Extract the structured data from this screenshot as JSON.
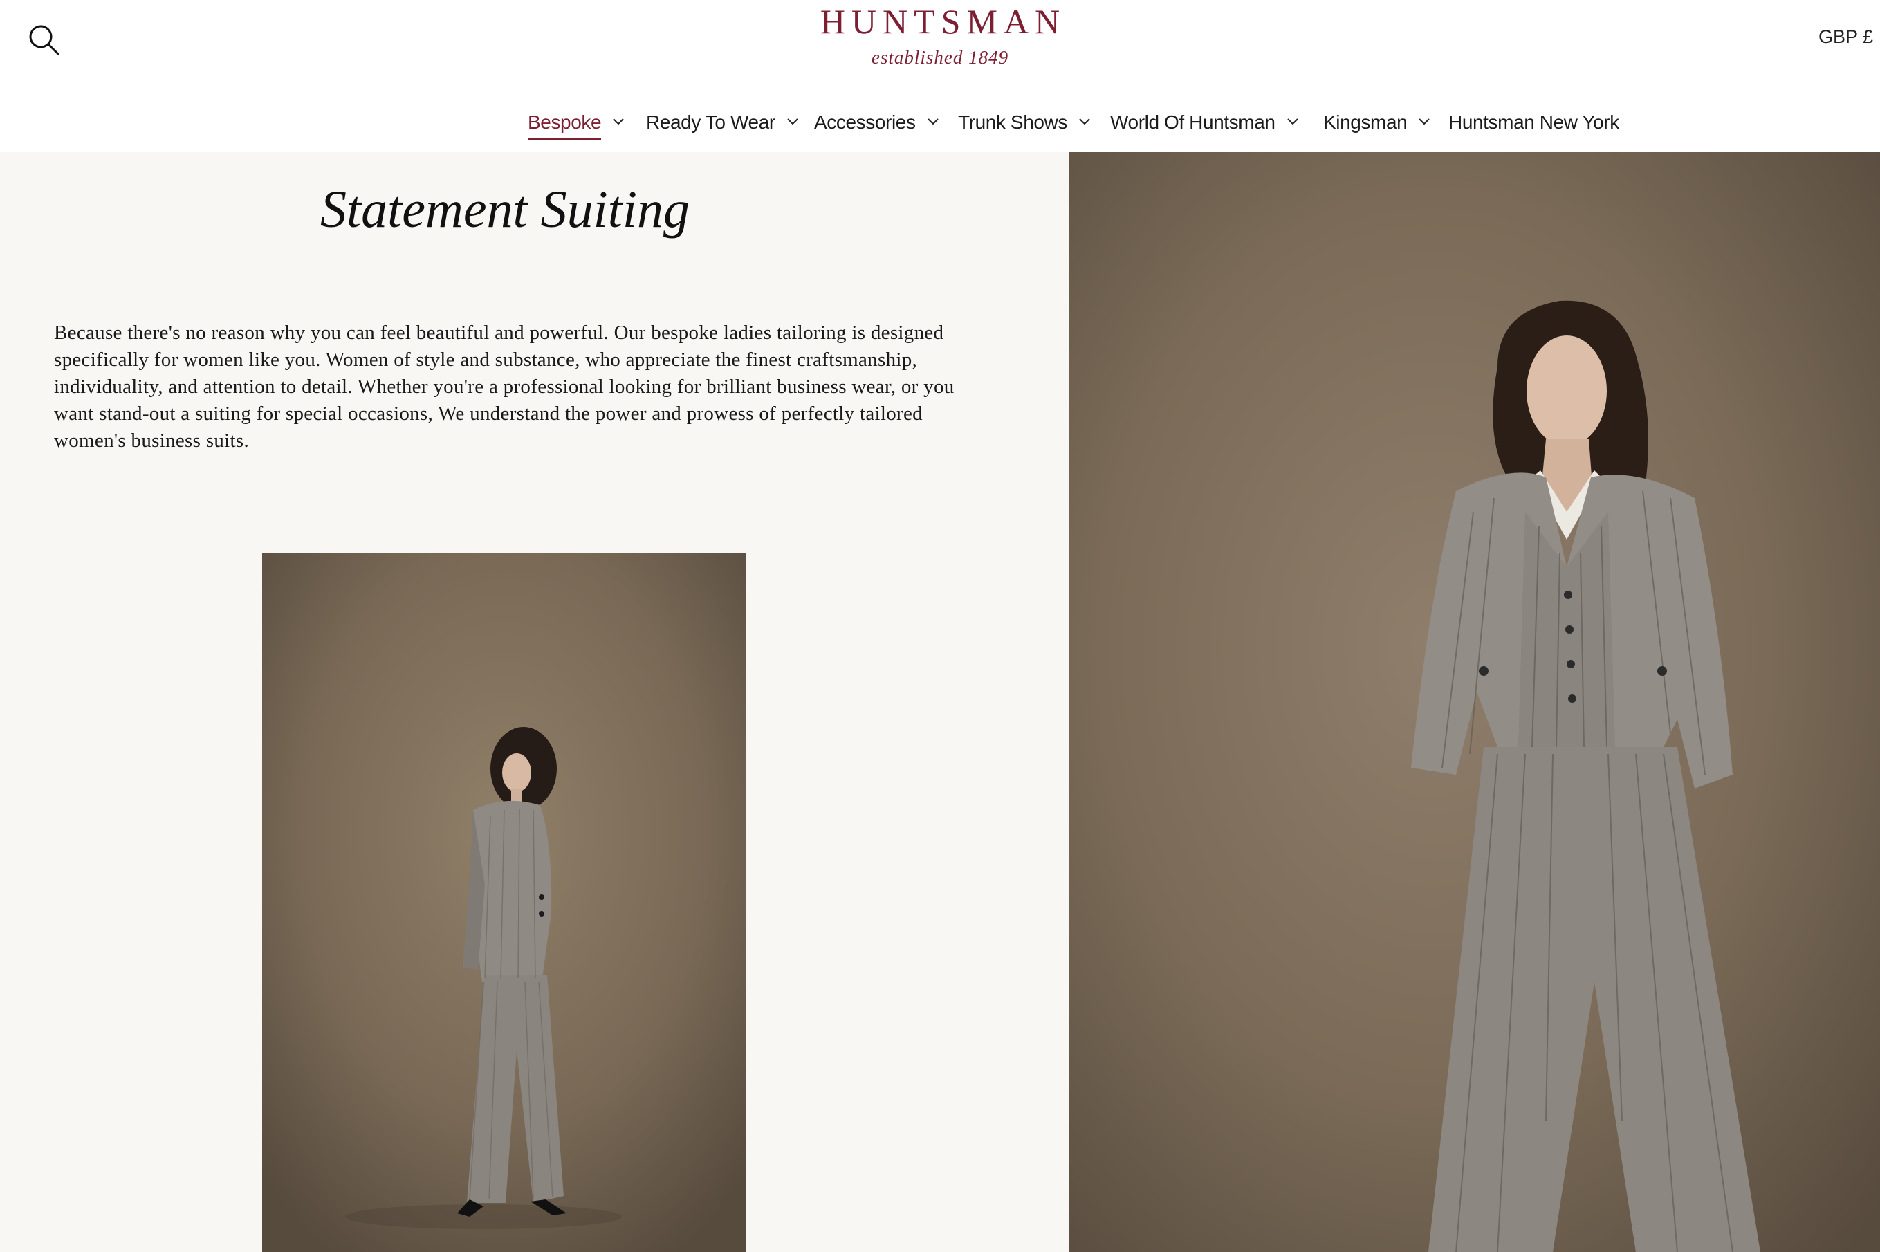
{
  "brand": {
    "wordmark": "HUNTSMAN",
    "tagline": "established 1849",
    "color": "#7d1f33"
  },
  "header": {
    "search_icon": "search-icon",
    "currency": "GBP £"
  },
  "nav": {
    "items": [
      {
        "label": "Bespoke",
        "active": true,
        "has_dropdown": true
      },
      {
        "label": "Ready To Wear",
        "active": false,
        "has_dropdown": true
      },
      {
        "label": "Accessories",
        "active": false,
        "has_dropdown": true
      },
      {
        "label": "Trunk Shows",
        "active": false,
        "has_dropdown": true
      },
      {
        "label": "World Of Huntsman",
        "active": false,
        "has_dropdown": true
      },
      {
        "label": "Kingsman",
        "active": false,
        "has_dropdown": true
      },
      {
        "label": "Huntsman New York",
        "active": false,
        "has_dropdown": false
      }
    ]
  },
  "main": {
    "heading": "Statement Suiting",
    "body": "Because there's no reason why you can feel beautiful and powerful. Our bespoke ladies tailoring is designed specifically for women like you. Women of style and substance, who appreciate the finest craftsmanship, individuality, and attention to detail. Whether you're a professional looking for brilliant business wear, or you want stand-out a suiting for special occasions, We understand the power and prowess of perfectly tailored women's business suits."
  },
  "colors": {
    "panel_background": "#f8f7f3",
    "photo_backdrop": "#7e6e5b",
    "suit_grey": "#8f8a83"
  }
}
